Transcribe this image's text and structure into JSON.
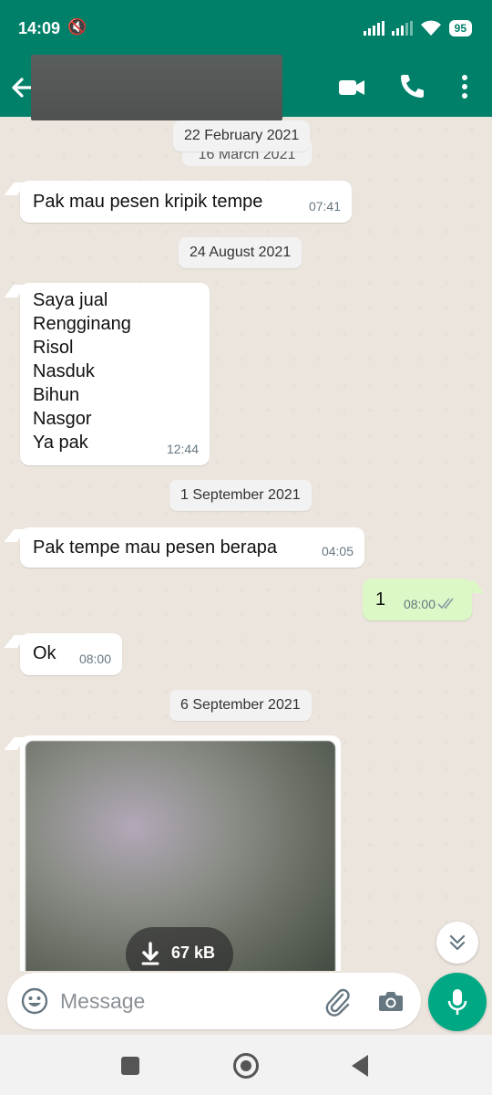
{
  "status_bar": {
    "time": "14:09",
    "icons": [
      "muted-icon",
      "nfc-icon",
      "message-icon",
      "n-icon",
      "app-icon",
      "more-icon"
    ],
    "battery": "95"
  },
  "header": {
    "contact_name": "",
    "icons": [
      "back-icon",
      "video-call-icon",
      "phone-icon",
      "menu-icon"
    ]
  },
  "chat": {
    "hidden_date": "16 March 2021",
    "messages": [
      {
        "type": "date",
        "text": "22 February 2021"
      },
      {
        "type": "in",
        "text": "Pak mau pesen kripik tempe",
        "time": "07:41"
      },
      {
        "type": "date",
        "text": "24 August 2021"
      },
      {
        "type": "in",
        "text": "Saya jual\nRengginang\nRisol\nNasduk\nBihun\nNasgor\nYa pak",
        "time": "12:44"
      },
      {
        "type": "date",
        "text": "1 September 2021"
      },
      {
        "type": "in",
        "text": "Pak tempe mau pesen berapa",
        "time": "04:05"
      },
      {
        "type": "out",
        "text": "1",
        "time": "08:00",
        "status": "delivered"
      },
      {
        "type": "in",
        "text": "Ok",
        "time": "08:00"
      },
      {
        "type": "date",
        "text": "6 September 2021"
      },
      {
        "type": "image",
        "download_size": "67 kB"
      }
    ]
  },
  "composer": {
    "placeholder": "Message"
  },
  "colors": {
    "header": "#008069",
    "chat_bg": "#ECE5DD",
    "outgoing": "#DCF8C6",
    "incoming": "#FFFFFF",
    "send": "#00A884"
  }
}
